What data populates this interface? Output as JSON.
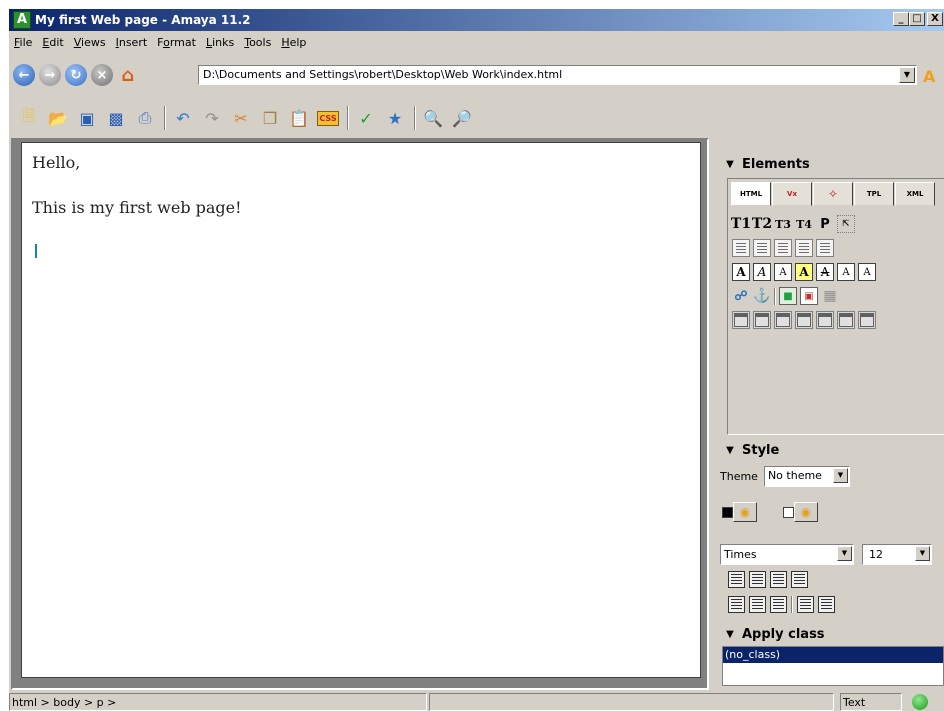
{
  "window": {
    "title": "My first Web page - Amaya 11.2",
    "app_icon": "amaya-icon",
    "controls": {
      "minimize": "_",
      "maximize": "□",
      "close": "X"
    }
  },
  "menu": [
    {
      "u": "F",
      "rest": "ile"
    },
    {
      "u": "E",
      "rest": "dit"
    },
    {
      "u": "V",
      "rest": "iews"
    },
    {
      "u": "I",
      "rest": "nsert"
    },
    {
      "pre": "F",
      "u": "o",
      "rest": "rmat"
    },
    {
      "u": "L",
      "rest": "inks"
    },
    {
      "u": "T",
      "rest": "ools"
    },
    {
      "u": "H",
      "rest": "elp"
    }
  ],
  "navigation": {
    "url": "D:\\Documents and Settings\\robert\\Desktop\\Web Work\\index.html"
  },
  "toolbar_icons": [
    "new-document-icon",
    "open-folder-icon",
    "save-icon",
    "save-all-icon",
    "print-icon",
    "undo-icon",
    "redo-icon",
    "cut-icon",
    "copy-icon",
    "paste-icon",
    "css-icon",
    "spellcheck-icon",
    "transform-icon",
    "zoom-in-icon",
    "zoom-out-icon"
  ],
  "editor": {
    "paragraphs": [
      "Hello,",
      "This is my first web page!"
    ]
  },
  "elements_panel": {
    "title": "Elements",
    "tabs": [
      "HTML",
      "Vx",
      "",
      "TPL",
      "XML"
    ],
    "heading_buttons": [
      "T1",
      "T2",
      "T3",
      "T4",
      "P"
    ],
    "char_buttons": [
      "A",
      "A",
      "A",
      "A",
      "A",
      "A",
      "A"
    ]
  },
  "style_panel": {
    "title": "Style",
    "theme_label": "Theme",
    "theme_value": "No theme",
    "font_family": "Times",
    "font_size": "12"
  },
  "apply_class": {
    "title": "Apply class",
    "items": [
      "(no_class)"
    ]
  },
  "status": {
    "path": "html > body > p >",
    "mode": "Text"
  },
  "colors": {
    "titlebar_start": "#0a246a",
    "selection": "#0a246a",
    "caret": "#1a7fbf"
  }
}
